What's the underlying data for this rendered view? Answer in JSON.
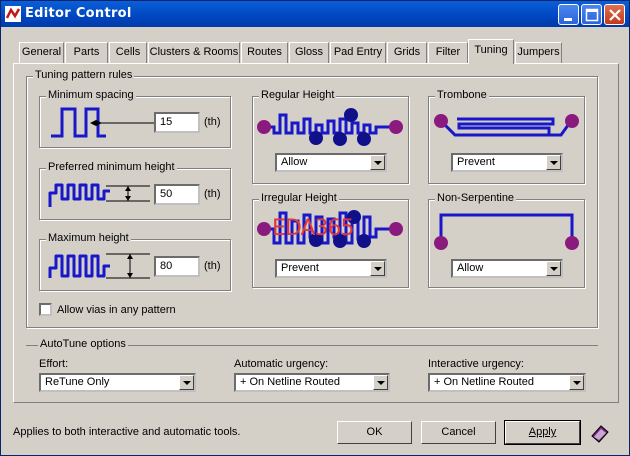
{
  "window": {
    "title": "Editor Control"
  },
  "tabs": [
    "General",
    "Parts",
    "Cells",
    "Clusters & Rooms",
    "Routes",
    "Gloss",
    "Pad Entry",
    "Grids",
    "Filter",
    "Tuning",
    "Jumpers"
  ],
  "active_tab": "Tuning",
  "tuning_rules": {
    "label": "Tuning pattern rules",
    "minimum_spacing": {
      "label": "Minimum spacing",
      "value": "15",
      "unit": "(th)"
    },
    "preferred_min_height": {
      "label": "Preferred minimum height",
      "value": "50",
      "unit": "(th)"
    },
    "maximum_height": {
      "label": "Maximum height",
      "value": "80",
      "unit": "(th)"
    },
    "regular_height": {
      "label": "Regular Height",
      "value": "Allow"
    },
    "irregular_height": {
      "label": "Irregular Height",
      "value": "Prevent"
    },
    "trombone": {
      "label": "Trombone",
      "value": "Prevent"
    },
    "non_serpentine": {
      "label": "Non-Serpentine",
      "value": "Allow"
    },
    "allow_vias": {
      "label": "Allow vias in any pattern",
      "checked": false
    }
  },
  "watermark": "EDA365",
  "autotune": {
    "label": "AutoTune options",
    "effort": {
      "label": "Effort:",
      "value": "ReTune Only"
    },
    "automatic_urgency": {
      "label": "Automatic urgency:",
      "value": "+ On Netline Routed"
    },
    "interactive_urgency": {
      "label": "Interactive urgency:",
      "value": "+ On Netline Routed"
    }
  },
  "status_text": "Applies to both interactive and automatic tools.",
  "buttons": {
    "ok": "OK",
    "cancel": "Cancel",
    "apply": "Apply"
  },
  "colors": {
    "trace": "#1818c8",
    "pad": "#8b1a7e",
    "via": "#10108a",
    "title_bar": "#0a5fd8",
    "watermark": "#e03838"
  },
  "icons": [
    "app-icon",
    "minimize-icon",
    "maximize-icon",
    "close-icon",
    "help-book-icon"
  ]
}
